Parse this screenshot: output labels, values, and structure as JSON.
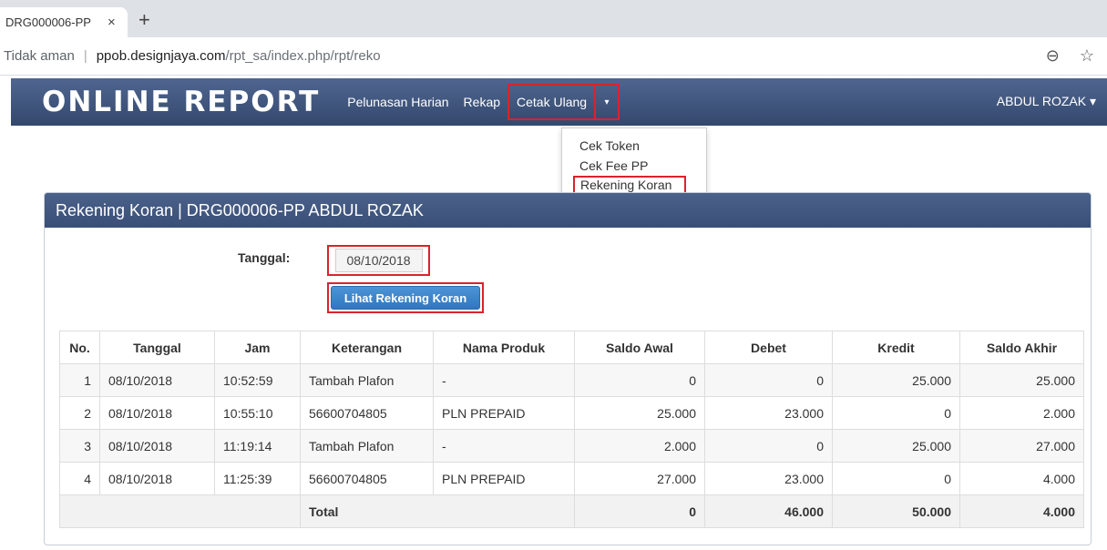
{
  "browser": {
    "tab_title": "DRG000006-PP",
    "tab_close": "×",
    "new_tab": "+",
    "security": "Tidak aman",
    "separator": "|",
    "url_host": "ppob.designjaya.com",
    "url_path": "/rpt_sa/index.php/rpt/reko",
    "zoom_icon": "⊖",
    "star_icon": "☆"
  },
  "navbar": {
    "brand": "ONLINE REPORT",
    "links": [
      "Pelunasan Harian",
      "Rekap",
      "Cetak Ulang"
    ],
    "caret": "▾",
    "user": "ABDUL ROZAK ▾"
  },
  "dropdown": {
    "items": [
      "Cek Token",
      "Cek Fee PP",
      "Rekening Koran"
    ]
  },
  "panel": {
    "title": "Rekening Koran | DRG000006-PP ABDUL ROZAK",
    "date_label": "Tanggal:",
    "date_value": "08/10/2018",
    "button_label": "Lihat Rekening Koran"
  },
  "table": {
    "headers": [
      "No.",
      "Tanggal",
      "Jam",
      "Keterangan",
      "Nama Produk",
      "Saldo Awal",
      "Debet",
      "Kredit",
      "Saldo Akhir"
    ],
    "rows": [
      [
        "1",
        "08/10/2018",
        "10:52:59",
        "Tambah Plafon",
        "-",
        "0",
        "0",
        "25.000",
        "25.000"
      ],
      [
        "2",
        "08/10/2018",
        "10:55:10",
        "56600704805",
        "PLN PREPAID",
        "25.000",
        "23.000",
        "0",
        "2.000"
      ],
      [
        "3",
        "08/10/2018",
        "11:19:14",
        "Tambah Plafon",
        "-",
        "2.000",
        "0",
        "25.000",
        "27.000"
      ],
      [
        "4",
        "08/10/2018",
        "11:25:39",
        "56600704805",
        "PLN PREPAID",
        "27.000",
        "23.000",
        "0",
        "4.000"
      ]
    ],
    "total": {
      "label": "Total",
      "saldo_awal": "0",
      "debet": "46.000",
      "kredit": "50.000",
      "saldo_akhir": "4.000"
    }
  },
  "colors": {
    "highlight": "#d9232d",
    "navbar": "#3f5479",
    "button": "#337ab7"
  }
}
